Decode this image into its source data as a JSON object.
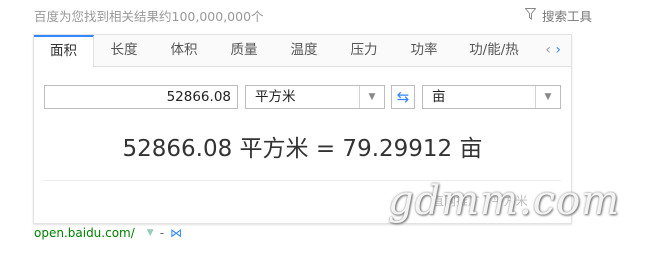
{
  "results_summary": "百度为您找到相关结果约100,000,000个",
  "search_tools": "搜索工具",
  "tabs": [
    "面积",
    "长度",
    "体积",
    "质量",
    "温度",
    "压力",
    "功率",
    "功/能/热"
  ],
  "converter": {
    "input_value": "52866.08",
    "from_unit": "平方米",
    "to_unit": "亩",
    "result": "52866.08 平方米 = 79.29912 亩"
  },
  "watermark": "gdmm.com",
  "faint_text": "直网推广 | 平方米",
  "source_url": "open.baidu.com/",
  "source_dash": "-",
  "icons": {
    "filter": "funnel-icon",
    "prev": "chevron-left-icon",
    "next": "chevron-right-icon",
    "swap": "swap-arrows-icon",
    "dropdown": "caret-down-icon",
    "bow": "bow-tie-icon"
  },
  "colors": {
    "accent": "#3388ff",
    "url": "#008000",
    "text": "#333333",
    "muted": "#999999"
  }
}
